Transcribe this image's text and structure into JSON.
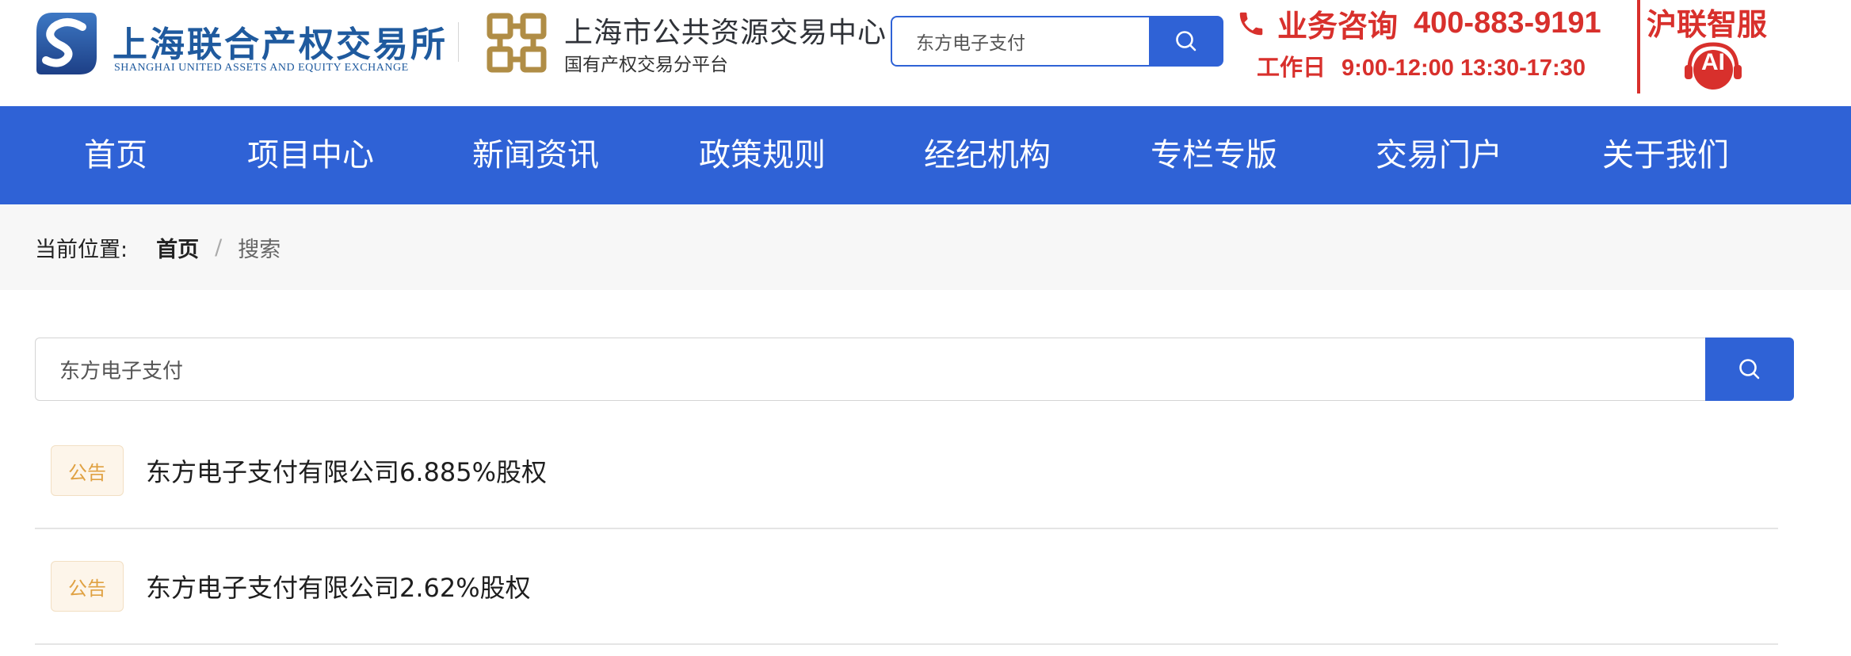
{
  "header": {
    "logo1": {
      "name_cn": "上海联合产权交易所",
      "name_en": "SHANGHAI UNITED ASSETS AND EQUITY EXCHANGE"
    },
    "logo2": {
      "title": "上海市公共资源交易中心",
      "subtitle": "国有产权交易分平台"
    },
    "search": {
      "value": "东方电子支付"
    },
    "contact": {
      "label": "业务咨询",
      "phone": "400-883-9191",
      "days": "工作日",
      "hours": "9:00-12:00 13:30-17:30"
    },
    "ai_service": {
      "title": "沪联智服",
      "badge": "AI"
    }
  },
  "nav": {
    "items": [
      {
        "label": "首页"
      },
      {
        "label": "项目中心"
      },
      {
        "label": "新闻资讯"
      },
      {
        "label": "政策规则"
      },
      {
        "label": "经纪机构"
      },
      {
        "label": "专栏专版"
      },
      {
        "label": "交易门户"
      },
      {
        "label": "关于我们"
      }
    ]
  },
  "breadcrumb": {
    "current_label": "当前位置:",
    "home": "首页",
    "separator": "/",
    "page": "搜索"
  },
  "main_search": {
    "value": "东方电子支付"
  },
  "results": [
    {
      "tag": "公告",
      "title": "东方电子支付有限公司6.885%股权"
    },
    {
      "tag": "公告",
      "title": "东方电子支付有限公司2.62%股权"
    }
  ],
  "colors": {
    "brand_blue": "#2f62d6",
    "logo_blue": "#1f5a9e",
    "accent_red": "#d8302c",
    "tag_orange": "#e0a142"
  }
}
